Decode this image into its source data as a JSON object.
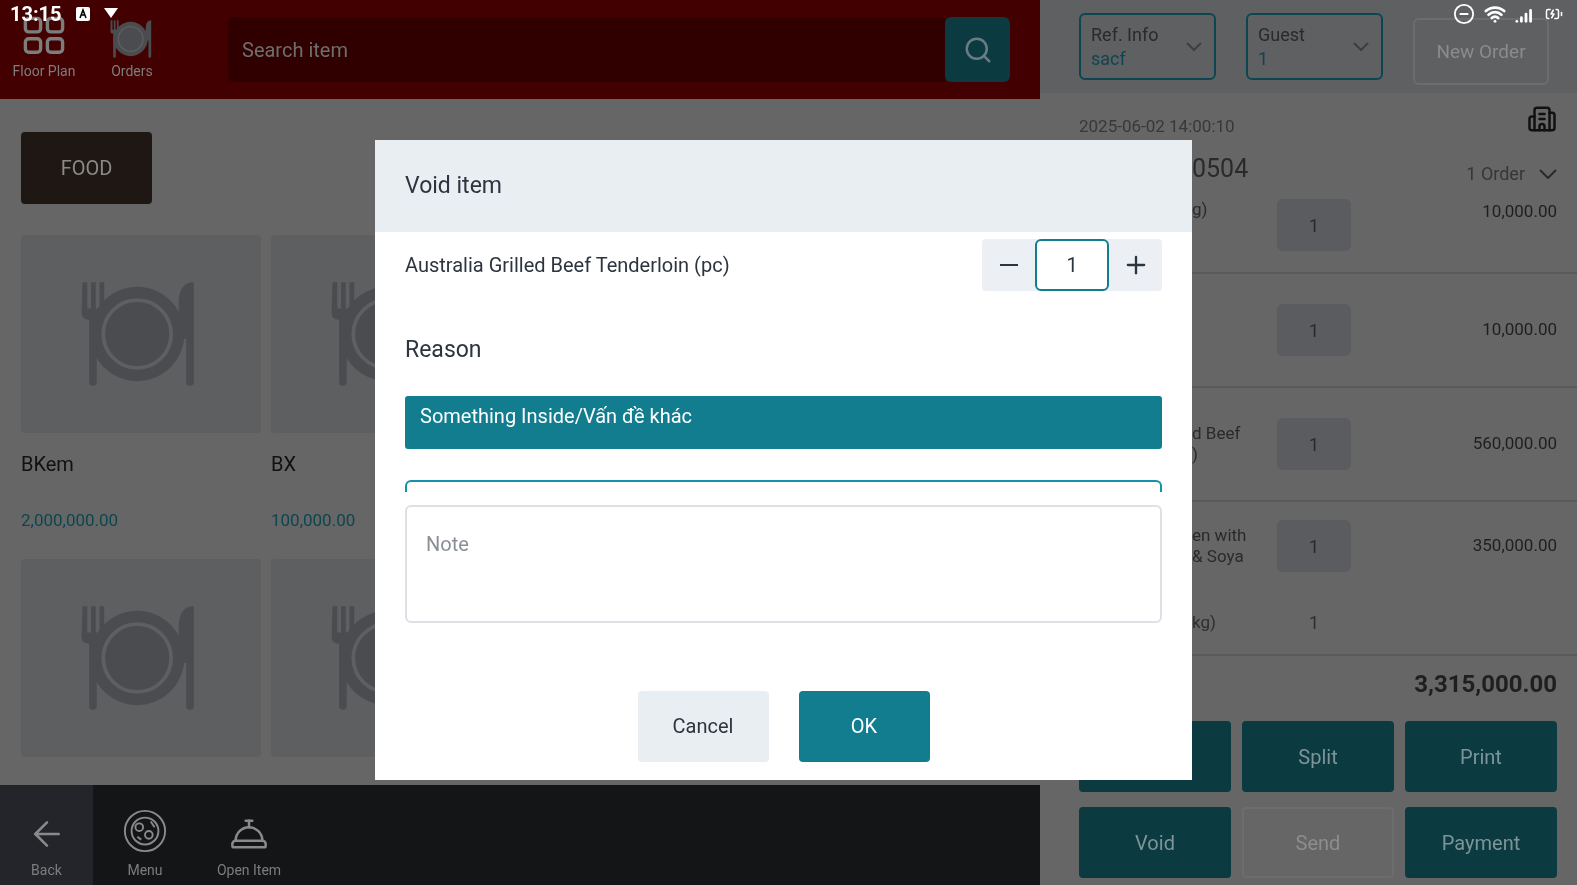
{
  "status_bar": {
    "time": "13:15"
  },
  "top_bar": {
    "nav": [
      {
        "label": "Floor Plan",
        "kind": "grid"
      },
      {
        "label": "Orders",
        "kind": "plate"
      }
    ],
    "search": {
      "placeholder": "Search item"
    }
  },
  "categories": [
    {
      "label": "FOOD",
      "selected": true
    }
  ],
  "items": [
    {
      "kind": "item",
      "name": "BKem",
      "price": "2,000,000.00"
    },
    {
      "kind": "item",
      "name": "BX",
      "price": "100,000.00"
    },
    {
      "kind": "placeholder"
    },
    {
      "kind": "placeholder"
    }
  ],
  "bottom_nav": [
    {
      "label": "Back",
      "kind": "back"
    },
    {
      "label": "Menu",
      "kind": "menu"
    },
    {
      "label": "Open Item",
      "kind": "open_item"
    }
  ],
  "order_panel": {
    "ref": {
      "label": "Ref. Info",
      "value": "sacf"
    },
    "guest": {
      "label": "Guest",
      "value": "1"
    },
    "new_order": {
      "label": "New Order",
      "disabled": true
    },
    "date": "2025-06-02 14:00:10",
    "number": "0504",
    "orders": "1 Order",
    "lines": [
      {
        "kind": "line",
        "name": [
          "g)"
        ],
        "qty": "1",
        "price": "10,000.00"
      },
      {
        "kind": "line",
        "qty": "1",
        "price": "10,000.00"
      },
      {
        "kind": "line",
        "name": [
          "d Beef",
          ")"
        ],
        "qty": "1",
        "price": "560,000.00"
      },
      {
        "kind": "line",
        "name": [
          "en with",
          "& Soya"
        ],
        "qty": "1",
        "price": "350,000.00"
      },
      {
        "kind": "sub",
        "name": [
          "kg)"
        ],
        "qty": "1"
      }
    ],
    "total": "3,315,000.00",
    "actions": [
      {
        "kind": "covered",
        "disabled": false
      },
      {
        "kind": "button",
        "label": "Split",
        "disabled": false
      },
      {
        "kind": "button",
        "label": "Print",
        "disabled": false
      },
      {
        "kind": "button",
        "label": "Void",
        "disabled": false
      },
      {
        "kind": "button",
        "label": "Send",
        "disabled": true
      },
      {
        "kind": "button",
        "label": "Payment",
        "disabled": false
      }
    ]
  },
  "dialog": {
    "title": "Void item",
    "item": "Australia Grilled Beef Tenderloin (pc)",
    "quantity": "1",
    "reason_label": "Reason",
    "reasons": [
      {
        "label": "Something Inside/Vấn đề khác",
        "selected": true
      }
    ],
    "note": {
      "placeholder": "Note"
    },
    "buttons": [
      {
        "label": "Cancel",
        "kind": "secondary"
      },
      {
        "label": "OK",
        "kind": "primary"
      }
    ]
  }
}
